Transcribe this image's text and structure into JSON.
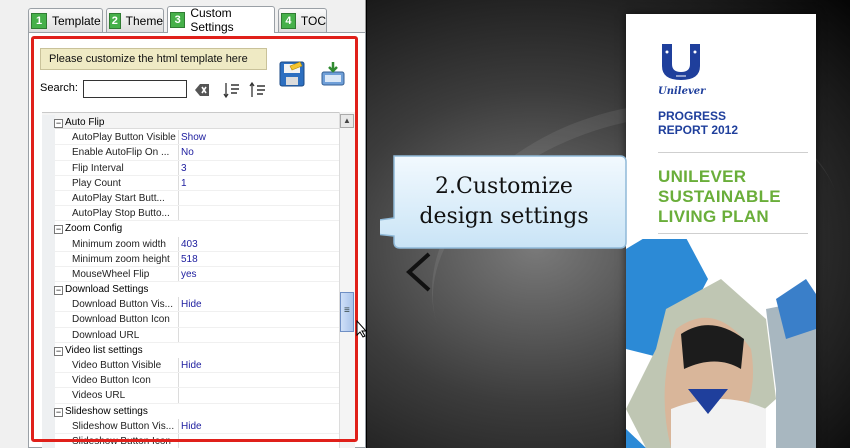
{
  "tabs": [
    {
      "num": "1",
      "label": "Template"
    },
    {
      "num": "2",
      "label": "Theme"
    },
    {
      "num": "3",
      "label": "Custom Settings"
    },
    {
      "num": "4",
      "label": "TOC"
    }
  ],
  "active_tab": "Custom Settings",
  "customize_button": "Please customize the html template here",
  "search": {
    "label": "Search:",
    "value": ""
  },
  "grid_rows": [
    {
      "type": "cat",
      "name": "Auto Flip"
    },
    {
      "type": "prop",
      "name": "AutoPlay Button Visible",
      "value": "Show"
    },
    {
      "type": "prop",
      "name": "Enable AutoFlip On ...",
      "value": "No"
    },
    {
      "type": "prop",
      "name": "Flip Interval",
      "value": "3"
    },
    {
      "type": "prop",
      "name": "Play Count",
      "value": "1"
    },
    {
      "type": "prop",
      "name": "AutoPlay Start Butt...",
      "value": ""
    },
    {
      "type": "prop",
      "name": "AutoPlay Stop Butto...",
      "value": ""
    },
    {
      "type": "cat",
      "name": "Zoom Config"
    },
    {
      "type": "prop",
      "name": "Minimum zoom width",
      "value": "403"
    },
    {
      "type": "prop",
      "name": "Minimum zoom height",
      "value": "518"
    },
    {
      "type": "prop",
      "name": "MouseWheel Flip",
      "value": "yes"
    },
    {
      "type": "cat",
      "name": "Download Settings"
    },
    {
      "type": "prop",
      "name": "Download Button Vis...",
      "value": "Hide"
    },
    {
      "type": "prop",
      "name": "Download Button Icon",
      "value": ""
    },
    {
      "type": "prop",
      "name": "Download URL",
      "value": ""
    },
    {
      "type": "cat",
      "name": "Video list settings"
    },
    {
      "type": "prop",
      "name": "Video Button Visible",
      "value": "Hide"
    },
    {
      "type": "prop",
      "name": "Video Button Icon",
      "value": ""
    },
    {
      "type": "prop",
      "name": "Videos URL",
      "value": ""
    },
    {
      "type": "cat",
      "name": "Slideshow settings"
    },
    {
      "type": "prop",
      "name": "Slideshow Button Vis...",
      "value": "Hide"
    },
    {
      "type": "prop",
      "name": "Slideshow Button Icon",
      "value": ""
    }
  ],
  "callout": {
    "line1": "2.Customize",
    "line2": "design settings"
  },
  "book": {
    "brand": "Unilever",
    "title_line1": "PROGRESS",
    "title_line2": "REPORT 2012",
    "plan_line1": "UNILEVER",
    "plan_line2": "SUSTAINABLE",
    "plan_line3": "LIVING PLAN"
  },
  "colors": {
    "accent_red": "#e0201a",
    "brand_blue": "#1f3f9c",
    "plan_green": "#6aae3a",
    "tab_green": "#46b04a"
  }
}
